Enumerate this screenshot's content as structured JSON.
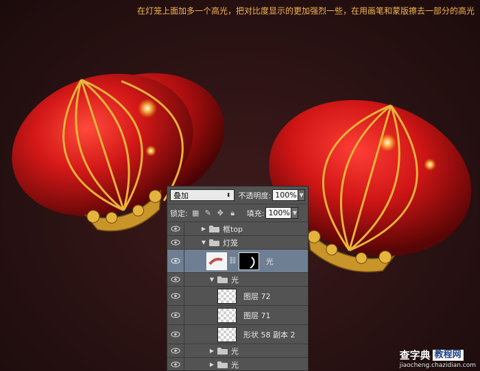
{
  "caption": "在灯笼上面加多一个高光，把对比度显示的更加强烈一些，在用画笔和蒙版擦去一部分的高光",
  "layers_panel": {
    "blend_mode": "叠加",
    "opacity_label": "不透明度:",
    "opacity_value": "100%",
    "lock_label": "锁定:",
    "fill_label": "填充:",
    "fill_value": "100%",
    "layers": [
      {
        "name": "框top",
        "type": "group",
        "expanded": false
      },
      {
        "name": "灯笼",
        "type": "group",
        "expanded": true
      },
      {
        "name": "光",
        "type": "layer-with-mask",
        "selected": true
      },
      {
        "name": "光",
        "type": "group",
        "expanded": true
      },
      {
        "name": "图层 72",
        "type": "layer"
      },
      {
        "name": "图层 71",
        "type": "layer"
      },
      {
        "name": "形状 58 副本 2",
        "type": "layer"
      },
      {
        "name": "光",
        "type": "group",
        "expanded": false
      },
      {
        "name": "光",
        "type": "group",
        "expanded": false
      }
    ]
  },
  "watermark": {
    "brand": "查字典",
    "box": "教程网",
    "url": "jiaocheng.chazidian.com"
  },
  "colors": {
    "accent_text": "#f3b74f",
    "lantern_red": "#d11a1a",
    "gold": "#e8b53a",
    "panel_bg": "#535353",
    "selected_row": "#6e7f93"
  }
}
